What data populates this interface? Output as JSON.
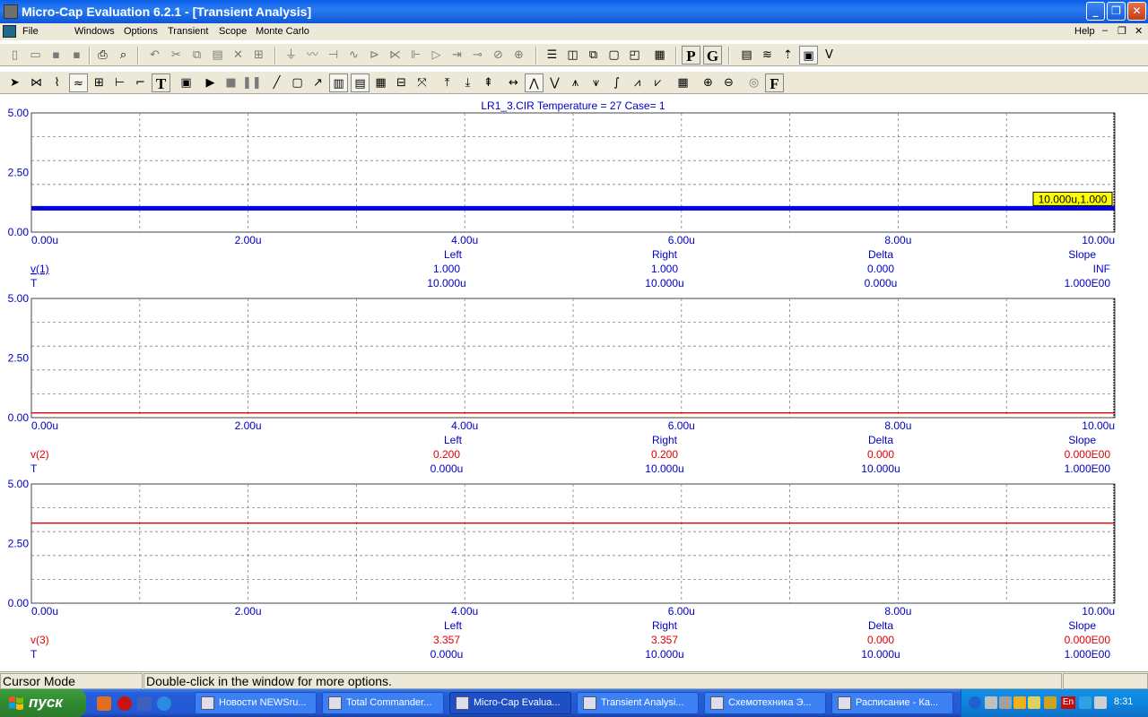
{
  "window": {
    "title": "Micro-Cap Evaluation 6.2.1 - [Transient Analysis]",
    "minimize": "_",
    "restore": "❐",
    "close": "✕"
  },
  "menu": {
    "items": [
      "File",
      "Windows",
      "Options",
      "Transient",
      "Scope",
      "Monte Carlo"
    ],
    "help": "Help",
    "mdi_min": "–",
    "mdi_restore": "❐",
    "mdi_close": "✕"
  },
  "toolbar1": {
    "buttons": [
      "new-icon",
      "open-icon",
      "save-icon",
      "save-as-icon",
      "print-icon",
      "print-preview-icon",
      "undo-icon",
      "cut-icon",
      "copy-icon",
      "paste-icon",
      "delete-icon",
      "select-all-icon",
      "ground-icon",
      "resistor-icon",
      "capacitor-icon",
      "inductor-icon",
      "diode-icon",
      "bjt-icon",
      "mosfet-icon",
      "opamp-icon",
      "buffer-icon",
      "switch-icon",
      "source-icon",
      "battery-icon",
      "tile-horizontal-icon",
      "tile-vertical-icon",
      "cascade-icon",
      "window-icon",
      "restore-icon",
      "calculator-icon",
      "p-icon",
      "g-icon",
      "netlist-icon",
      "analysis-icon",
      "probe-icon",
      "scope-icon",
      "variable-icon"
    ],
    "p_label": "P",
    "g_label": "G"
  },
  "toolbar2": {
    "text_tool": "T",
    "f_label": "F"
  },
  "colors": {
    "blue_trace": "#0000e0",
    "red_trace": "#e00000",
    "axis_text": "#0000c0",
    "cursor_tag_bg": "#ffff00"
  },
  "chart_data": [
    {
      "type": "line",
      "title": "LR1_3.CIR Temperature = 27 Case= 1",
      "x_ticks": [
        "0.00u",
        "2.00u",
        "4.00u",
        "6.00u",
        "8.00u",
        "10.00u"
      ],
      "xlim": [
        0,
        10
      ],
      "y_ticks": [
        "5.00",
        "2.50",
        "0.00"
      ],
      "ylim": [
        0,
        5
      ],
      "series": [
        {
          "name": "v(1)",
          "x": [
            0,
            10
          ],
          "values": [
            1.0,
            1.0
          ]
        }
      ],
      "cursor_tag": "10.000u,1.000",
      "readout": {
        "headers": [
          "Left",
          "Right",
          "Delta",
          "Slope"
        ],
        "rows": [
          {
            "label": "v(1)",
            "values": [
              "1.000",
              "1.000",
              "0.000",
              "INF"
            ]
          },
          {
            "label": "T",
            "values": [
              "10.000u",
              "10.000u",
              "0.000u",
              "1.000E00"
            ]
          }
        ]
      }
    },
    {
      "type": "line",
      "x_ticks": [
        "0.00u",
        "2.00u",
        "4.00u",
        "6.00u",
        "8.00u",
        "10.00u"
      ],
      "xlim": [
        0,
        10
      ],
      "y_ticks": [
        "5.00",
        "2.50",
        "0.00"
      ],
      "ylim": [
        0,
        5
      ],
      "series": [
        {
          "name": "v(2)",
          "x": [
            0,
            10
          ],
          "values": [
            0.2,
            0.2
          ]
        }
      ],
      "readout": {
        "headers": [
          "Left",
          "Right",
          "Delta",
          "Slope"
        ],
        "rows": [
          {
            "label": "v(2)",
            "values": [
              "0.200",
              "0.200",
              "0.000",
              "0.000E00"
            ]
          },
          {
            "label": "T",
            "values": [
              "0.000u",
              "10.000u",
              "10.000u",
              "1.000E00"
            ]
          }
        ]
      }
    },
    {
      "type": "line",
      "x_ticks": [
        "0.00u",
        "2.00u",
        "4.00u",
        "6.00u",
        "8.00u",
        "10.00u"
      ],
      "xlim": [
        0,
        10
      ],
      "y_ticks": [
        "5.00",
        "2.50",
        "0.00"
      ],
      "ylim": [
        0,
        5
      ],
      "series": [
        {
          "name": "v(3)",
          "x": [
            0,
            10
          ],
          "values": [
            3.357,
            3.357
          ]
        }
      ],
      "readout": {
        "headers": [
          "Left",
          "Right",
          "Delta",
          "Slope"
        ],
        "rows": [
          {
            "label": "v(3)",
            "values": [
              "3.357",
              "3.357",
              "0.000",
              "0.000E00"
            ]
          },
          {
            "label": "T",
            "values": [
              "0.000u",
              "10.000u",
              "10.000u",
              "1.000E00"
            ]
          }
        ]
      }
    }
  ],
  "status": {
    "mode": "Cursor Mode",
    "hint": "Double-click in the window for more options."
  },
  "taskbar": {
    "start_label": "пуск",
    "tasks": [
      {
        "label": "Новости NEWSru...",
        "icon": "opera-icon"
      },
      {
        "label": "Total Commander...",
        "icon": "floppy-icon"
      },
      {
        "label": "Micro-Cap Evalua...",
        "icon": "microcap-icon",
        "active": true
      },
      {
        "label": "Transient Analysi...",
        "icon": "window-icon"
      },
      {
        "label": "Схемотехника Э...",
        "icon": "word-icon"
      },
      {
        "label": "Расписание - Ка...",
        "icon": "excel-icon"
      }
    ],
    "lang": "En",
    "clock": "8:31"
  }
}
